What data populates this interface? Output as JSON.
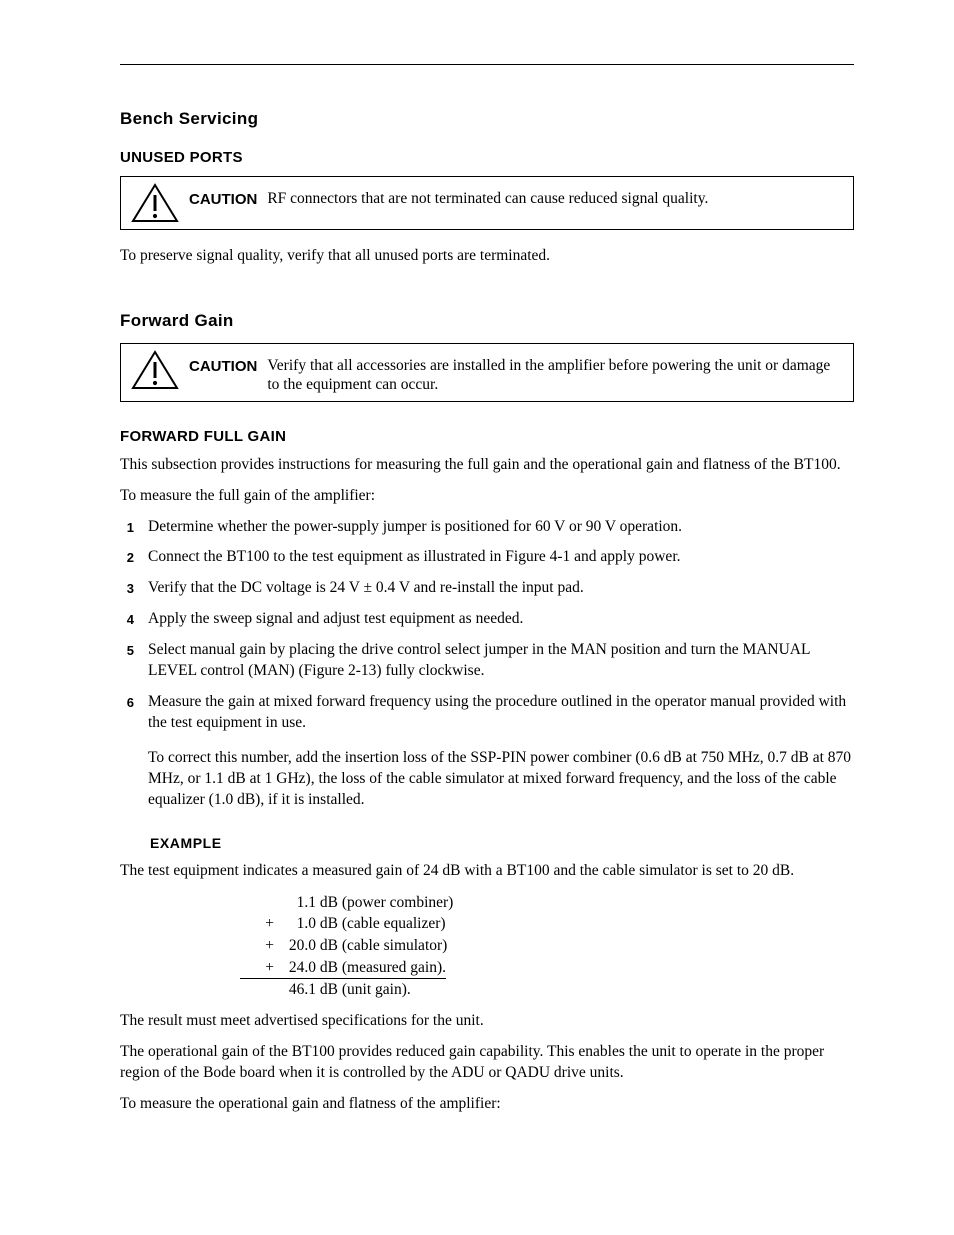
{
  "header_section_title": "Bench Servicing",
  "unused_ports": {
    "heading": "UNUSED PORTS",
    "caution_label": "CAUTION",
    "caution_body": "RF connectors that are not terminated can cause reduced signal quality.",
    "body": "To preserve signal quality, verify that all unused ports are terminated."
  },
  "forward_gain": {
    "heading": "Forward Gain",
    "caution_label": "CAUTION",
    "caution_body": "Verify that all accessories are installed in the amplifier before powering the unit or damage to the equipment can occur.",
    "subheading": "FORWARD FULL GAIN",
    "intro": "This subsection provides instructions for measuring the full gain and the operational gain and flatness of the BT100.",
    "lead_in": "To measure the full gain of the amplifier:",
    "steps": [
      "Determine whether the power-supply jumper is positioned for 60 V or 90 V operation.",
      "Connect the BT100 to the test equipment as illustrated in Figure 4-1 and apply power.",
      "Verify that the DC voltage is 24 V ± 0.4 V and re-install the input pad.",
      "Apply the sweep signal and adjust test equipment as needed.",
      "Select manual gain by placing the drive control select jumper in the MAN position and turn the MANUAL LEVEL control (MAN) (Figure 2-13) fully clockwise.",
      "Measure the gain at mixed forward frequency using the procedure outlined in the operator manual provided with the test equipment in use."
    ],
    "step6_extra": "To correct this number, add the insertion loss of the SSP-PIN power combiner (0.6 dB at 750 MHz, 0.7 dB at 870 MHz, or 1.1 dB at 1 GHz), the loss of the cable simulator at mixed forward frequency, and the loss of the cable equalizer (1.0 dB), if it is installed.",
    "example_heading": "EXAMPLE",
    "example_intro": "The test equipment indicates a measured gain of 24 dB with a BT100 and the cable simulator is set to 20 dB.",
    "calc": [
      {
        "sign": "",
        "val": "1.1 dB",
        "label": "(power combiner)"
      },
      {
        "sign": "+",
        "val": "1.0 dB",
        "label": "(cable equalizer)"
      },
      {
        "sign": "+",
        "val": "20.0 dB",
        "label": "(cable simulator)"
      },
      {
        "sign": "+",
        "val": "24.0 dB",
        "label": "(measured gain).",
        "underline": true
      },
      {
        "sign": "",
        "val": "46.1 dB",
        "label": "(unit gain)."
      }
    ],
    "post_calc": "The result must meet advertised specifications for the unit.",
    "op_gain_para": "The operational gain of the BT100 provides reduced gain capability. This enables the unit to operate in the proper region of the Bode board when it is controlled by the ADU or QADU drive units.",
    "op_gain_lead": "To measure the operational gain and flatness of the amplifier:"
  }
}
